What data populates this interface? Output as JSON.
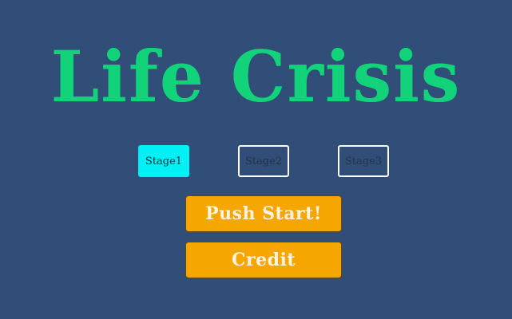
{
  "title": "Life Crisis",
  "stages": [
    {
      "label": "Stage1",
      "selected": true
    },
    {
      "label": "Stage2",
      "selected": false
    },
    {
      "label": "Stage3",
      "selected": false
    }
  ],
  "menu": {
    "start_label": "Push Start!",
    "credit_label": "Credit"
  },
  "colors": {
    "background": "#304e78",
    "title": "#12d27a",
    "stage_selected": "#00f0f5",
    "button": "#f6a600"
  }
}
